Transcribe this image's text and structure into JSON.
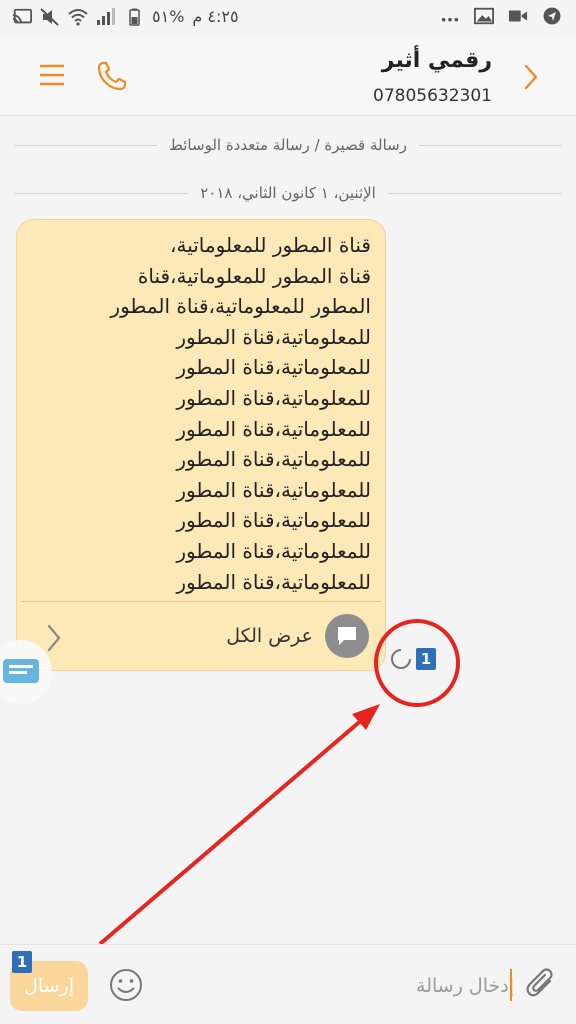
{
  "status_bar": {
    "time": "٤:٢٥ م",
    "battery": "%٥١",
    "icons": [
      "battery-icon",
      "signal-icon",
      "wifi-icon",
      "mute-icon",
      "cast-icon",
      "more-notifications-icon",
      "gallery-icon",
      "video-icon",
      "navigation-icon"
    ]
  },
  "header": {
    "contact_name": "رقمي أثير",
    "contact_number": "07805632301",
    "accent_color": "#f08a24"
  },
  "conversation": {
    "message_type": "رسالة قصيرة / رسالة متعددة الوسائط",
    "date": "الإثنين، ١ كانون الثاني، ٢٠١٨",
    "message": {
      "lines": [
        "قناة المطور للمعلوماتية،",
        "قناة المطور للمعلوماتية،قناة",
        "المطور للمعلوماتية،قناة المطور",
        "للمعلوماتية،قناة المطور",
        "للمعلوماتية،قناة المطور",
        "للمعلوماتية،قناة المطور",
        "للمعلوماتية،قناة المطور",
        "للمعلوماتية،قناة المطور",
        "للمعلوماتية،قناة المطور",
        "للمعلوماتية،قناة المطور",
        "للمعلوماتية،قناة المطور",
        "للمعلوماتية،قناة المطور"
      ],
      "view_all_label": "عرض الكل",
      "sim_slot": "1"
    }
  },
  "composer": {
    "placeholder": "إدخال رسالة",
    "send_label": "إرسال",
    "sim_slot": "1"
  }
}
